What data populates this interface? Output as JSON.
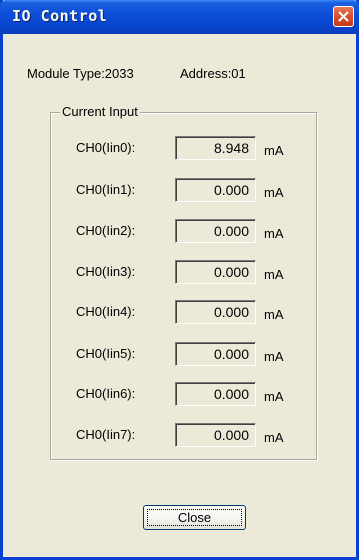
{
  "window": {
    "title": "IO Control"
  },
  "info": {
    "module_type": "Module Type:2033",
    "address": "Address:01"
  },
  "group": {
    "label": "Current Input",
    "rows": [
      {
        "label": "CH0(Iin0):",
        "value": "8.948",
        "unit": "mA"
      },
      {
        "label": "CH0(Iin1):",
        "value": "0.000",
        "unit": "mA"
      },
      {
        "label": "CH0(Iin2):",
        "value": "0.000",
        "unit": "mA"
      },
      {
        "label": "CH0(Iin3):",
        "value": "0.000",
        "unit": "mA"
      },
      {
        "label": "CH0(Iin4):",
        "value": "0.000",
        "unit": "mA"
      },
      {
        "label": "CH0(Iin5):",
        "value": "0.000",
        "unit": "mA"
      },
      {
        "label": "CH0(Iin6):",
        "value": "0.000",
        "unit": "mA"
      },
      {
        "label": "CH0(Iin7):",
        "value": "0.000",
        "unit": "mA"
      }
    ]
  },
  "buttons": {
    "close_label": "Close"
  },
  "icons": {
    "title_close": "close-icon"
  },
  "colors": {
    "titlebar": "#0846cf",
    "close_button": "#d9532f",
    "background": "#ece9d8"
  }
}
